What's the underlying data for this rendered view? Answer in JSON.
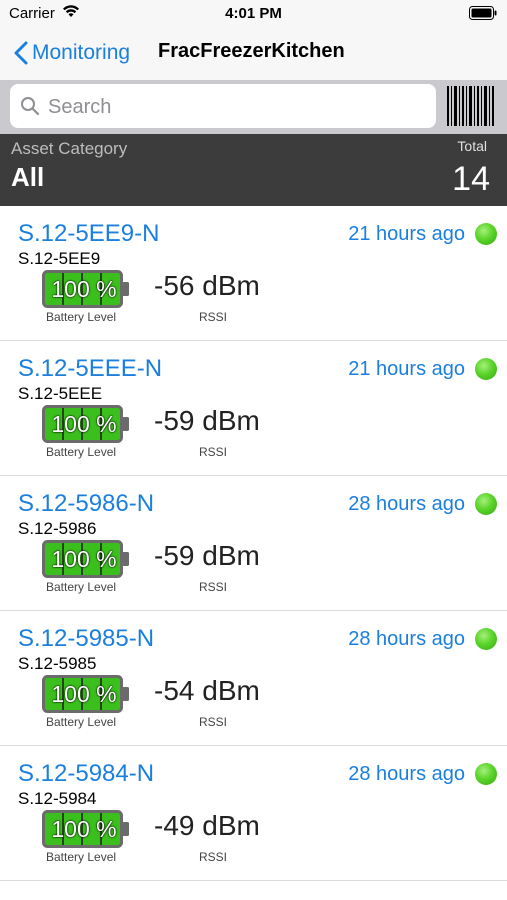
{
  "status": {
    "carrier": "Carrier",
    "time": "4:01 PM"
  },
  "nav": {
    "back_label": "Monitoring",
    "title": "FracFreezerKitchen"
  },
  "search": {
    "placeholder": "Search",
    "value": ""
  },
  "category": {
    "label": "Asset Category",
    "value": "All",
    "total_label": "Total",
    "total_value": "14"
  },
  "captions": {
    "battery": "Battery Level",
    "rssi": "RSSI"
  },
  "assets": [
    {
      "name": "S.12-5EE9-N",
      "sub": "S.12-5EE9",
      "time_ago": "21 hours ago",
      "battery": "100 %",
      "battery_level": 1.0,
      "rssi": "-56 dBm",
      "status_color": "#4fcf22"
    },
    {
      "name": "S.12-5EEE-N",
      "sub": "S.12-5EEE",
      "time_ago": "21 hours ago",
      "battery": "100 %",
      "battery_level": 1.0,
      "rssi": "-59 dBm",
      "status_color": "#4fcf22"
    },
    {
      "name": "S.12-5986-N",
      "sub": "S.12-5986",
      "time_ago": "28 hours ago",
      "battery": "100 %",
      "battery_level": 1.0,
      "rssi": "-59 dBm",
      "status_color": "#4fcf22"
    },
    {
      "name": "S.12-5985-N",
      "sub": "S.12-5985",
      "time_ago": "28 hours ago",
      "battery": "100 %",
      "battery_level": 1.0,
      "rssi": "-54 dBm",
      "status_color": "#4fcf22"
    },
    {
      "name": "S.12-5984-N",
      "sub": "S.12-5984",
      "time_ago": "28 hours ago",
      "battery": "100 %",
      "battery_level": 1.0,
      "rssi": "-49 dBm",
      "status_color": "#4fcf22"
    }
  ],
  "colors": {
    "accent": "#1a7fde",
    "category_bg": "#3c3c3c",
    "battery_fill": "#3bbf1c"
  }
}
